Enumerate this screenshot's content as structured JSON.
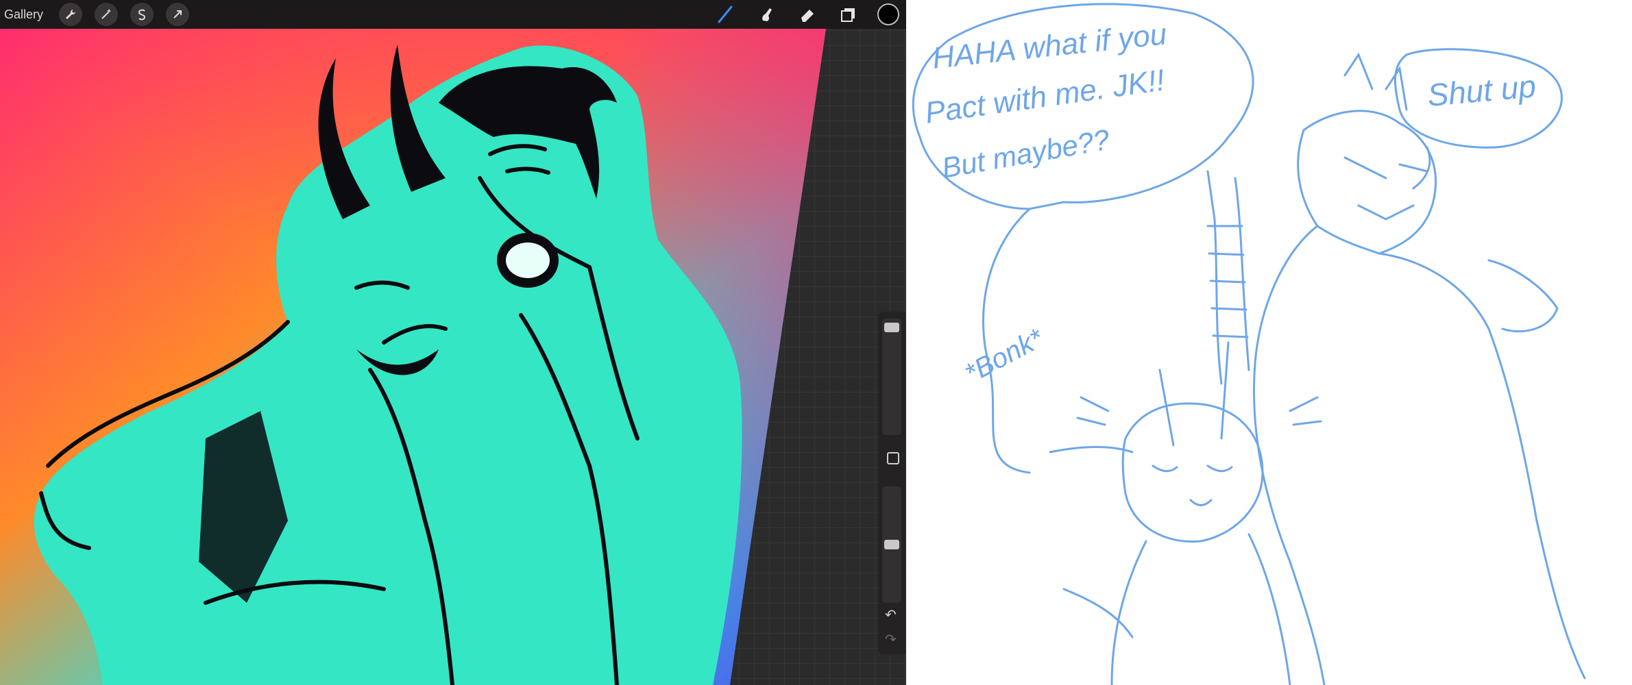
{
  "toolbar": {
    "gallery_label": "Gallery",
    "left_tools": [
      "wrench-icon",
      "magic-wand-icon",
      "selection-s-icon",
      "transform-arrow-icon"
    ],
    "right_tools": [
      "brush-icon",
      "smudge-icon",
      "eraser-icon",
      "layers-icon"
    ],
    "current_color": "#000000"
  },
  "colors": {
    "bg_pink": "#ff2d6f",
    "bg_orange": "#ff8a2a",
    "bg_blue": "#3d7df5",
    "figure_fill": "#34e6c4",
    "sketch_line": "#6ea6e8"
  },
  "sketch": {
    "bubble_left_line1": "HAHA what if you",
    "bubble_left_line2": "Pact with me. JK!!",
    "bubble_left_line3": "But maybe??",
    "bubble_right": "Shut up",
    "sound_effect": "*Bonk*"
  }
}
